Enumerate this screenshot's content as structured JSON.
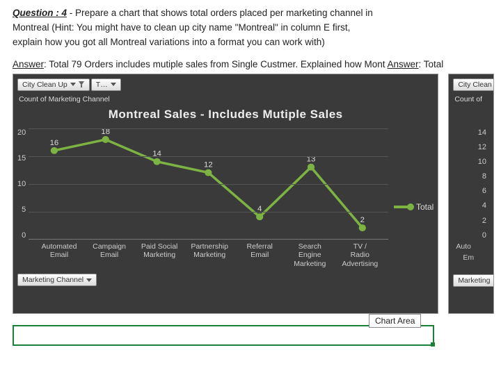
{
  "question": {
    "label": "Question : 4",
    "text_l1": " - Prepare a chart that shows total orders placed per marketing channel in",
    "text_l2": "Montreal (Hint: You might have to clean up city name \"Montreal\" in column E first,",
    "text_l3": "explain how you got all Montreal variations into a format you can work with)"
  },
  "answer": {
    "label": "Answer",
    "text": ": Total 79 Orders includes mutiple sales from Single Custmer. Explained how Mont ",
    "label2": "Answer",
    "text2": ": Total"
  },
  "main_chart": {
    "filter_btn": "City Clean Up",
    "filter_btn2": "T…",
    "count_label": "Count of Marketing Channel",
    "title": "Montreal Sales - Includes Mutiple Sales",
    "legend": "Total",
    "bottom_btn": "Marketing Channel",
    "x_labels": [
      "Automated Email",
      "Campaign Email",
      "Paid Social Marketing",
      "Partnership Marketing",
      "Referral Email",
      "Search Engine Marketing",
      "TV / Radio Advertising"
    ]
  },
  "side_chart": {
    "filter_btn": "City Clean",
    "count_label": "Count of",
    "y_ticks": [
      "14",
      "12",
      "10",
      "8",
      "6",
      "4",
      "2",
      "0"
    ],
    "x_labels": [
      "Auto",
      "Em"
    ],
    "bottom_btn": "Marketing"
  },
  "misc": {
    "chart_area_tip": "Chart Area"
  },
  "chart_data": {
    "type": "line",
    "title": "Montreal Sales - Includes Mutiple Sales",
    "xlabel": "",
    "ylabel": "",
    "ylim": [
      0,
      20
    ],
    "y_ticks": [
      0,
      5,
      10,
      15,
      20
    ],
    "categories": [
      "Automated Email",
      "Campaign Email",
      "Paid Social Marketing",
      "Partnership Marketing",
      "Referral Email",
      "Search Engine Marketing",
      "TV / Radio Advertising"
    ],
    "series": [
      {
        "name": "Total",
        "values": [
          16,
          18,
          14,
          12,
          4,
          13,
          2
        ]
      }
    ],
    "legend_position": "right",
    "grid": true
  }
}
